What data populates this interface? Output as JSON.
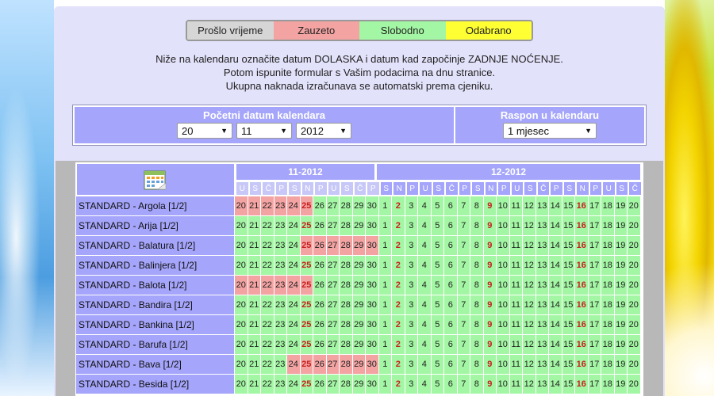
{
  "legend": {
    "past": "Prošlo vrijeme",
    "busy": "Zauzeto",
    "free": "Slobodno",
    "selected": "Odabrano"
  },
  "intro": [
    "Niže na kalendaru označite datum DOLASKA i datum kad započinje ZADNJE NOĆENJE.",
    "Potom ispunite formular s Vašim podacima na dnu stranice.",
    "Ukupna naknada izračunava se automatski prema cjeniku."
  ],
  "controls": {
    "start_title": "Početni datum kalendara",
    "day": "20",
    "month": "11",
    "year": "2012",
    "range_title": "Raspon u kalendaru",
    "range": "1 mjesec"
  },
  "calendar": {
    "months": [
      "11-2012",
      "12-2012"
    ],
    "dows": [
      "U",
      "S",
      "Č",
      "P",
      "S",
      "N",
      "P",
      "U",
      "S",
      "Č",
      "P",
      "S",
      "N",
      "P",
      "U",
      "S",
      "Č",
      "P",
      "S",
      "N",
      "P",
      "U",
      "S",
      "Č",
      "P",
      "S",
      "N",
      "P",
      "U",
      "S",
      "Č",
      "P"
    ],
    "days": [
      "20",
      "21",
      "22",
      "23",
      "24",
      "25",
      "26",
      "27",
      "28",
      "29",
      "30",
      "1",
      "2",
      "3",
      "4",
      "5",
      "6",
      "7",
      "8",
      "9",
      "10",
      "11",
      "12",
      "13",
      "14",
      "15",
      "16",
      "17",
      "18",
      "19",
      "20"
    ],
    "sunday_indices": [
      5,
      12,
      19,
      26
    ],
    "rows": [
      {
        "name": "STANDARD - Argola [1/2]",
        "busy": [
          0,
          1,
          2,
          3,
          4,
          5
        ]
      },
      {
        "name": "STANDARD - Arija [1/2]",
        "busy": []
      },
      {
        "name": "STANDARD - Balatura [1/2]",
        "busy": [
          5,
          6,
          7,
          8,
          9,
          10
        ]
      },
      {
        "name": "STANDARD - Balinjera [1/2]",
        "busy": []
      },
      {
        "name": "STANDARD - Balota [1/2]",
        "busy": [
          0,
          1,
          2,
          3,
          4,
          5
        ]
      },
      {
        "name": "STANDARD - Bandira [1/2]",
        "busy": []
      },
      {
        "name": "STANDARD - Bankina [1/2]",
        "busy": []
      },
      {
        "name": "STANDARD - Barufa [1/2]",
        "busy": []
      },
      {
        "name": "STANDARD - Bava [1/2]",
        "busy": [
          4,
          5,
          6,
          7,
          8,
          9,
          10
        ]
      },
      {
        "name": "STANDARD - Besida [1/2]",
        "busy": []
      }
    ]
  },
  "colors": {
    "past": "#d6d6d6",
    "busy": "#f4a3a3",
    "free": "#a3f6a3",
    "selected": "#ffff33",
    "header": "#a5a5fb",
    "sunday_text": "#c81e1e"
  }
}
